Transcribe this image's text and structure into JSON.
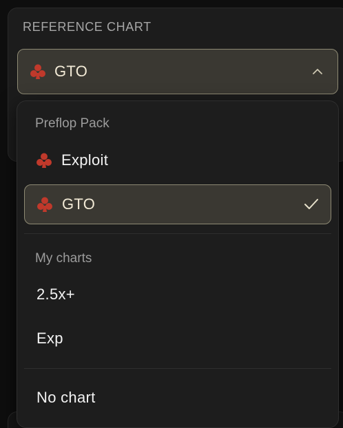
{
  "reference_chart": {
    "label": "REFERENCE CHART",
    "selected_value": "GTO",
    "icon": "club-icon",
    "chevron": "chevron-up-icon"
  },
  "dropdown": {
    "groups": [
      {
        "label": "Preflop Pack",
        "options": [
          {
            "label": "Exploit",
            "icon": "club-icon",
            "selected": false
          },
          {
            "label": "GTO",
            "icon": "club-icon",
            "selected": true
          }
        ]
      },
      {
        "label": "My charts",
        "options": [
          {
            "label": "2.5x+",
            "selected": false
          },
          {
            "label": "Exp",
            "selected": false
          }
        ]
      }
    ],
    "no_chart_label": "No chart",
    "check_icon": "checkmark-icon"
  },
  "colors": {
    "accent_border": "#8e8a74",
    "selected_bg": "#3a3832",
    "club_icon": "#c0392b",
    "panel_bg": "#1d1d1d"
  }
}
